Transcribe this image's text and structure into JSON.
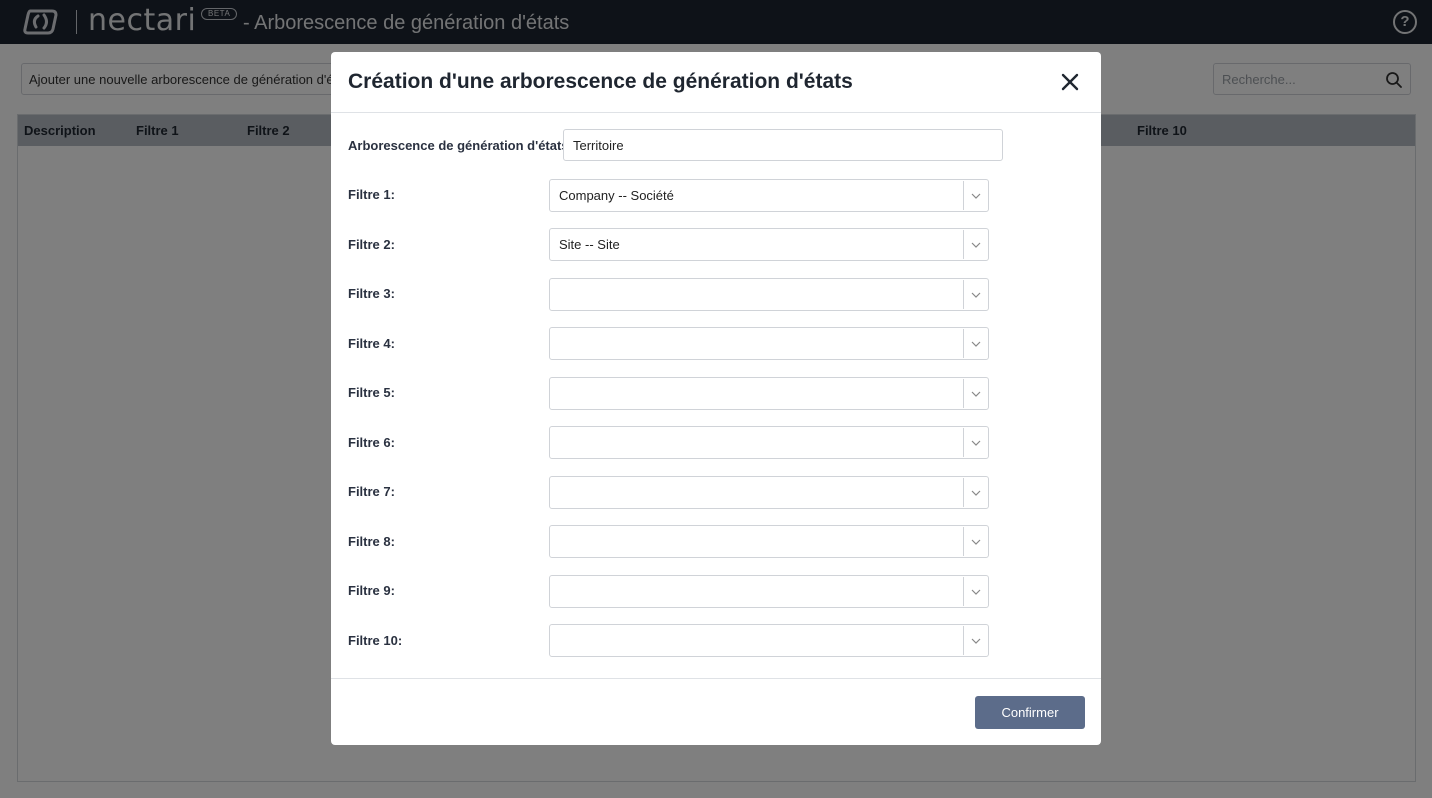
{
  "header": {
    "brand": "nectari",
    "beta_badge": "BETA",
    "title": "- Arborescence de génération d'états",
    "help_symbol": "?"
  },
  "toolbar": {
    "add_label": "Ajouter une nouvelle arborescence de génération d'états",
    "search_placeholder": "Recherche..."
  },
  "table": {
    "columns": [
      {
        "label": "Description"
      },
      {
        "label": "Filtre 1"
      },
      {
        "label": "Filtre 2"
      },
      {
        "label": "Filtre 10"
      }
    ]
  },
  "modal": {
    "title": "Création d'une arborescence de génération d'états",
    "tree_label": "Arborescence de génération d'états:",
    "tree_value": "Territoire",
    "filters": [
      {
        "label": "Filtre 1:",
        "value": "Company -- Société"
      },
      {
        "label": "Filtre 2:",
        "value": "Site -- Site"
      },
      {
        "label": "Filtre 3:",
        "value": ""
      },
      {
        "label": "Filtre 4:",
        "value": ""
      },
      {
        "label": "Filtre 5:",
        "value": ""
      },
      {
        "label": "Filtre 6:",
        "value": ""
      },
      {
        "label": "Filtre 7:",
        "value": ""
      },
      {
        "label": "Filtre 8:",
        "value": ""
      },
      {
        "label": "Filtre 9:",
        "value": ""
      },
      {
        "label": "Filtre 10:",
        "value": ""
      }
    ],
    "confirm_label": "Confirmer"
  },
  "colors": {
    "topbar": "#1c2430",
    "table_header": "#b4bac2",
    "confirm": "#5c6c8a",
    "overlay": "rgba(0,0,0,0.5)"
  },
  "icons": [
    "nectari-logo-icon",
    "help-icon",
    "search-icon",
    "close-icon",
    "chevron-down-icon"
  ]
}
